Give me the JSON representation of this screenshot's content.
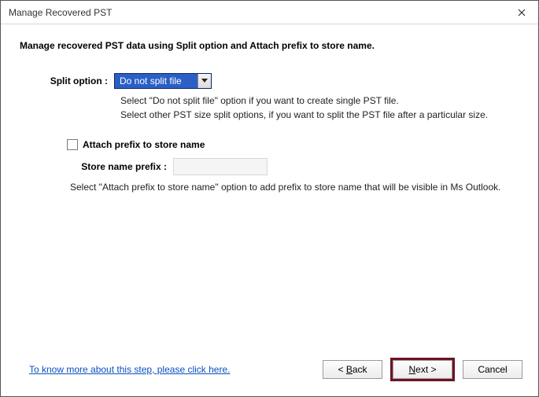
{
  "window": {
    "title": "Manage Recovered PST"
  },
  "heading": "Manage recovered PST data using Split option and Attach prefix to store name.",
  "split": {
    "label": "Split option :",
    "selected": "Do not split file",
    "hint1": "Select \"Do not split file\" option if you want to create single PST file.",
    "hint2": "Select other PST size split options, if you want to split the PST file after a particular size."
  },
  "prefix": {
    "checkbox_label": "Attach prefix to store name",
    "label": "Store name prefix :",
    "value": "",
    "hint": "Select \"Attach prefix to store name\" option to add prefix to store name that will be visible in Ms Outlook."
  },
  "footer": {
    "help_link": "To know more about this step, please click here.",
    "back": "< ",
    "back_u": "B",
    "back_rest": "ack",
    "next_u": "N",
    "next_rest": "ext >",
    "cancel": "Cancel"
  }
}
